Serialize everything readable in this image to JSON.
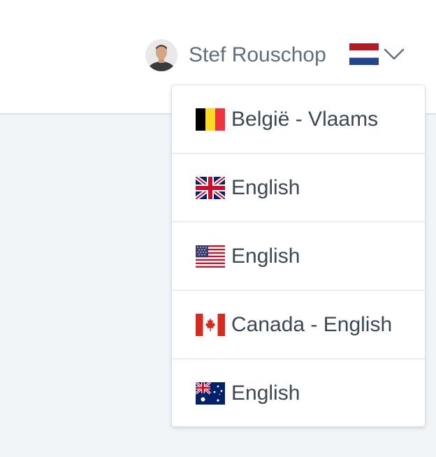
{
  "header": {
    "user_name": "Stef Rouschop",
    "avatar_icon": "user-avatar",
    "current_language_flag": "netherlands-flag-icon",
    "dropdown_icon": "chevron-down-icon"
  },
  "language_menu": {
    "items": [
      {
        "label": "België - Vlaams",
        "flag": "belgium-flag-icon"
      },
      {
        "label": "English",
        "flag": "uk-flag-icon"
      },
      {
        "label": "English",
        "flag": "us-flag-icon"
      },
      {
        "label": "Canada - English",
        "flag": "canada-flag-icon"
      },
      {
        "label": "English",
        "flag": "australia-flag-icon"
      }
    ]
  },
  "colors": {
    "topbar_bg": "#ffffff",
    "page_bg": "#f1f5f8",
    "border": "#dae1e7",
    "text": "#3d4852",
    "muted_text": "#606f7b"
  }
}
